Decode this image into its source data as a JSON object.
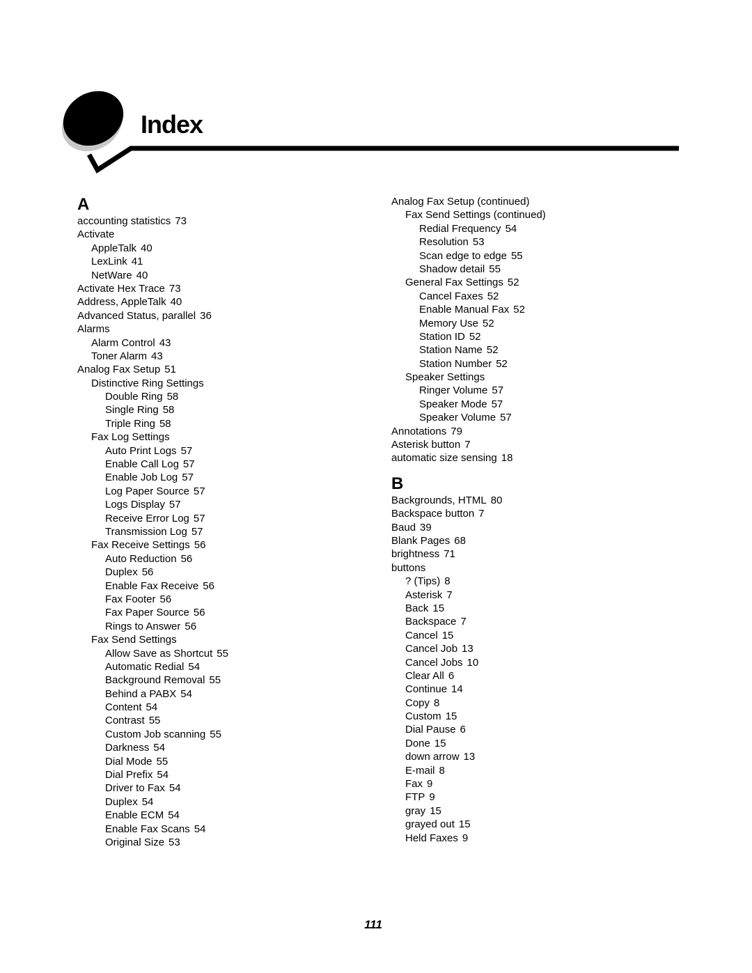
{
  "header": {
    "title": "Index"
  },
  "columns": [
    {
      "blocks": [
        {
          "type": "letter",
          "text": "A"
        },
        {
          "type": "entry",
          "level": 0,
          "term": "accounting statistics",
          "page": "73"
        },
        {
          "type": "entry",
          "level": 0,
          "term": "Activate",
          "page": ""
        },
        {
          "type": "entry",
          "level": 1,
          "term": "AppleTalk",
          "page": "40"
        },
        {
          "type": "entry",
          "level": 1,
          "term": "LexLink",
          "page": "41"
        },
        {
          "type": "entry",
          "level": 1,
          "term": "NetWare",
          "page": "40"
        },
        {
          "type": "entry",
          "level": 0,
          "term": "Activate Hex Trace",
          "page": "73"
        },
        {
          "type": "entry",
          "level": 0,
          "term": "Address, AppleTalk",
          "page": "40"
        },
        {
          "type": "entry",
          "level": 0,
          "term": "Advanced Status, parallel",
          "page": "36"
        },
        {
          "type": "entry",
          "level": 0,
          "term": "Alarms",
          "page": ""
        },
        {
          "type": "entry",
          "level": 1,
          "term": "Alarm Control",
          "page": "43"
        },
        {
          "type": "entry",
          "level": 1,
          "term": "Toner Alarm",
          "page": "43"
        },
        {
          "type": "entry",
          "level": 0,
          "term": "Analog Fax Setup",
          "page": "51"
        },
        {
          "type": "entry",
          "level": 1,
          "term": "Distinctive Ring Settings",
          "page": ""
        },
        {
          "type": "entry",
          "level": 2,
          "term": "Double Ring",
          "page": "58"
        },
        {
          "type": "entry",
          "level": 2,
          "term": "Single Ring",
          "page": "58"
        },
        {
          "type": "entry",
          "level": 2,
          "term": "Triple Ring",
          "page": "58"
        },
        {
          "type": "entry",
          "level": 1,
          "term": "Fax Log Settings",
          "page": ""
        },
        {
          "type": "entry",
          "level": 2,
          "term": "Auto Print Logs",
          "page": "57"
        },
        {
          "type": "entry",
          "level": 2,
          "term": "Enable Call Log",
          "page": "57"
        },
        {
          "type": "entry",
          "level": 2,
          "term": "Enable Job Log",
          "page": "57"
        },
        {
          "type": "entry",
          "level": 2,
          "term": "Log Paper Source",
          "page": "57"
        },
        {
          "type": "entry",
          "level": 2,
          "term": "Logs Display",
          "page": "57"
        },
        {
          "type": "entry",
          "level": 2,
          "term": "Receive Error Log",
          "page": "57"
        },
        {
          "type": "entry",
          "level": 2,
          "term": "Transmission Log",
          "page": "57"
        },
        {
          "type": "entry",
          "level": 1,
          "term": "Fax Receive Settings",
          "page": "56"
        },
        {
          "type": "entry",
          "level": 2,
          "term": "Auto Reduction",
          "page": "56"
        },
        {
          "type": "entry",
          "level": 2,
          "term": "Duplex",
          "page": "56"
        },
        {
          "type": "entry",
          "level": 2,
          "term": "Enable Fax Receive",
          "page": "56"
        },
        {
          "type": "entry",
          "level": 2,
          "term": "Fax Footer",
          "page": "56"
        },
        {
          "type": "entry",
          "level": 2,
          "term": "Fax Paper Source",
          "page": "56"
        },
        {
          "type": "entry",
          "level": 2,
          "term": "Rings to Answer",
          "page": "56"
        },
        {
          "type": "entry",
          "level": 1,
          "term": "Fax Send Settings",
          "page": ""
        },
        {
          "type": "entry",
          "level": 2,
          "term": "Allow Save as Shortcut",
          "page": "55"
        },
        {
          "type": "entry",
          "level": 2,
          "term": "Automatic Redial",
          "page": "54"
        },
        {
          "type": "entry",
          "level": 2,
          "term": "Background Removal",
          "page": "55"
        },
        {
          "type": "entry",
          "level": 2,
          "term": "Behind a PABX",
          "page": "54"
        },
        {
          "type": "entry",
          "level": 2,
          "term": "Content",
          "page": "54"
        },
        {
          "type": "entry",
          "level": 2,
          "term": "Contrast",
          "page": "55"
        },
        {
          "type": "entry",
          "level": 2,
          "term": "Custom Job scanning",
          "page": "55"
        },
        {
          "type": "entry",
          "level": 2,
          "term": "Darkness",
          "page": "54"
        },
        {
          "type": "entry",
          "level": 2,
          "term": "Dial Mode",
          "page": "55"
        },
        {
          "type": "entry",
          "level": 2,
          "term": "Dial Prefix",
          "page": "54"
        },
        {
          "type": "entry",
          "level": 2,
          "term": "Driver to Fax",
          "page": "54"
        },
        {
          "type": "entry",
          "level": 2,
          "term": "Duplex",
          "page": "54"
        },
        {
          "type": "entry",
          "level": 2,
          "term": "Enable ECM",
          "page": "54"
        },
        {
          "type": "entry",
          "level": 2,
          "term": "Enable Fax Scans",
          "page": "54"
        },
        {
          "type": "entry",
          "level": 2,
          "term": "Original Size",
          "page": "53"
        }
      ]
    },
    {
      "blocks": [
        {
          "type": "entry",
          "level": 0,
          "term": "Analog Fax Setup (continued)",
          "page": ""
        },
        {
          "type": "entry",
          "level": 1,
          "term": "Fax Send Settings (continued)",
          "page": ""
        },
        {
          "type": "entry",
          "level": 2,
          "term": "Redial Frequency",
          "page": "54"
        },
        {
          "type": "entry",
          "level": 2,
          "term": "Resolution",
          "page": "53"
        },
        {
          "type": "entry",
          "level": 2,
          "term": "Scan edge to edge",
          "page": "55"
        },
        {
          "type": "entry",
          "level": 2,
          "term": "Shadow detail",
          "page": "55"
        },
        {
          "type": "entry",
          "level": 1,
          "term": "General Fax Settings",
          "page": "52"
        },
        {
          "type": "entry",
          "level": 2,
          "term": "Cancel Faxes",
          "page": "52"
        },
        {
          "type": "entry",
          "level": 2,
          "term": "Enable Manual Fax",
          "page": "52"
        },
        {
          "type": "entry",
          "level": 2,
          "term": "Memory Use",
          "page": "52"
        },
        {
          "type": "entry",
          "level": 2,
          "term": "Station ID",
          "page": "52"
        },
        {
          "type": "entry",
          "level": 2,
          "term": "Station Name",
          "page": "52"
        },
        {
          "type": "entry",
          "level": 2,
          "term": "Station Number",
          "page": "52"
        },
        {
          "type": "entry",
          "level": 1,
          "term": "Speaker Settings",
          "page": ""
        },
        {
          "type": "entry",
          "level": 2,
          "term": "Ringer Volume",
          "page": "57"
        },
        {
          "type": "entry",
          "level": 2,
          "term": "Speaker Mode",
          "page": "57"
        },
        {
          "type": "entry",
          "level": 2,
          "term": "Speaker Volume",
          "page": "57"
        },
        {
          "type": "entry",
          "level": 0,
          "term": "Annotations",
          "page": "79"
        },
        {
          "type": "entry",
          "level": 0,
          "term": "Asterisk button",
          "page": "7"
        },
        {
          "type": "entry",
          "level": 0,
          "term": "automatic size sensing",
          "page": "18"
        },
        {
          "type": "letter",
          "text": "B"
        },
        {
          "type": "entry",
          "level": 0,
          "term": "Backgrounds, HTML",
          "page": "80"
        },
        {
          "type": "entry",
          "level": 0,
          "term": "Backspace button",
          "page": "7"
        },
        {
          "type": "entry",
          "level": 0,
          "term": "Baud",
          "page": "39"
        },
        {
          "type": "entry",
          "level": 0,
          "term": "Blank Pages",
          "page": "68"
        },
        {
          "type": "entry",
          "level": 0,
          "term": "brightness",
          "page": "71"
        },
        {
          "type": "entry",
          "level": 0,
          "term": "buttons",
          "page": ""
        },
        {
          "type": "entry",
          "level": 1,
          "term": "? (Tips)",
          "page": "8"
        },
        {
          "type": "entry",
          "level": 1,
          "term": "Asterisk",
          "page": "7"
        },
        {
          "type": "entry",
          "level": 1,
          "term": "Back",
          "page": "15"
        },
        {
          "type": "entry",
          "level": 1,
          "term": "Backspace",
          "page": "7"
        },
        {
          "type": "entry",
          "level": 1,
          "term": "Cancel",
          "page": "15"
        },
        {
          "type": "entry",
          "level": 1,
          "term": "Cancel Job",
          "page": "13"
        },
        {
          "type": "entry",
          "level": 1,
          "term": "Cancel Jobs",
          "page": "10"
        },
        {
          "type": "entry",
          "level": 1,
          "term": "Clear All",
          "page": "6"
        },
        {
          "type": "entry",
          "level": 1,
          "term": "Continue",
          "page": "14"
        },
        {
          "type": "entry",
          "level": 1,
          "term": "Copy",
          "page": "8"
        },
        {
          "type": "entry",
          "level": 1,
          "term": "Custom",
          "page": "15"
        },
        {
          "type": "entry",
          "level": 1,
          "term": "Dial Pause",
          "page": "6"
        },
        {
          "type": "entry",
          "level": 1,
          "term": "Done",
          "page": "15"
        },
        {
          "type": "entry",
          "level": 1,
          "term": "down arrow",
          "page": "13"
        },
        {
          "type": "entry",
          "level": 1,
          "term": "E-mail",
          "page": "8"
        },
        {
          "type": "entry",
          "level": 1,
          "term": "Fax",
          "page": "9"
        },
        {
          "type": "entry",
          "level": 1,
          "term": "FTP",
          "page": "9"
        },
        {
          "type": "entry",
          "level": 1,
          "term": "gray",
          "page": "15"
        },
        {
          "type": "entry",
          "level": 1,
          "term": "grayed out",
          "page": "15"
        },
        {
          "type": "entry",
          "level": 1,
          "term": "Held Faxes",
          "page": "9"
        }
      ]
    }
  ],
  "footer": {
    "page_number": "111"
  }
}
